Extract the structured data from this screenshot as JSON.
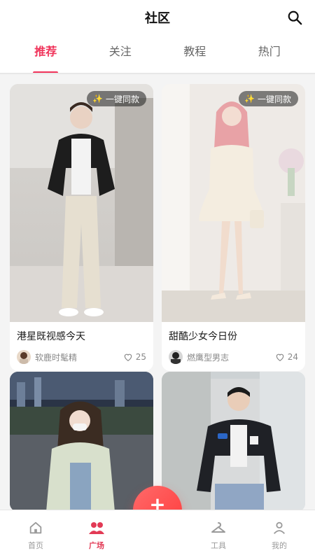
{
  "header": {
    "title": "社区",
    "tabs": [
      {
        "label": "推荐",
        "active": true
      },
      {
        "label": "关注",
        "active": false
      },
      {
        "label": "教程",
        "active": false
      },
      {
        "label": "热门",
        "active": false
      }
    ]
  },
  "feed": {
    "badge_label": "一键同款",
    "cards": [
      {
        "title": "港星既视感今天",
        "author": "软鹿时髦精",
        "likes": "25"
      },
      {
        "title": "甜酷少女今日份",
        "author": "燃鹰型男志",
        "likes": "24"
      },
      {
        "title": "",
        "author": "",
        "likes": ""
      },
      {
        "title": "",
        "author": "",
        "likes": ""
      }
    ]
  },
  "fab": {
    "label": "发布",
    "icon": "plus-icon"
  },
  "bottom_nav": [
    {
      "label": "首页",
      "icon": "home-icon",
      "active": false
    },
    {
      "label": "广场",
      "icon": "community-icon",
      "active": true
    },
    {
      "label": "工具",
      "icon": "hanger-icon",
      "active": false
    },
    {
      "label": "我的",
      "icon": "user-icon",
      "active": false
    }
  ],
  "colors": {
    "accent": "#f0335a",
    "nav_active": "#e23a55",
    "fab": "#ff4545"
  }
}
